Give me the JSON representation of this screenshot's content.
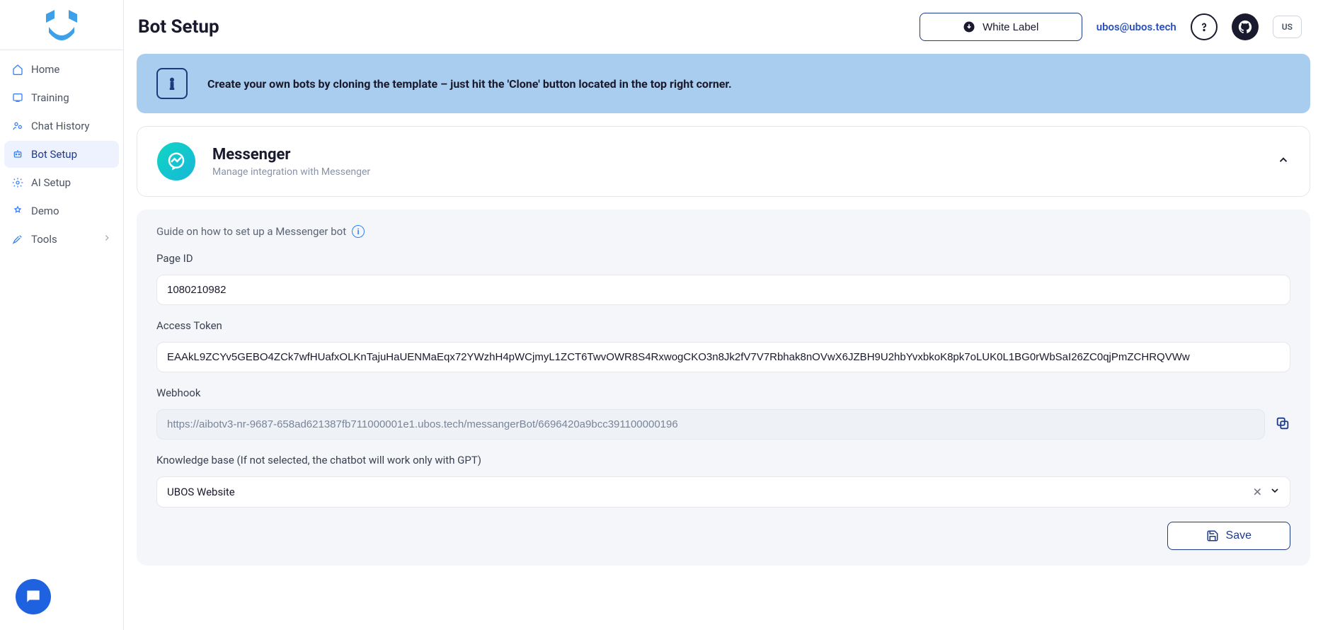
{
  "sidebar": {
    "items": [
      {
        "label": "Home",
        "icon": "home-icon"
      },
      {
        "label": "Training",
        "icon": "training-icon"
      },
      {
        "label": "Chat History",
        "icon": "chat-history-icon"
      },
      {
        "label": "Bot Setup",
        "icon": "bot-setup-icon"
      },
      {
        "label": "AI Setup",
        "icon": "ai-setup-icon"
      },
      {
        "label": "Demo",
        "icon": "demo-icon"
      },
      {
        "label": "Tools",
        "icon": "tools-icon"
      }
    ]
  },
  "header": {
    "title": "Bot Setup",
    "white_label": "White Label",
    "email": "ubos@ubos.tech",
    "locale": "US"
  },
  "banner": {
    "text": "Create your own bots by cloning the template – just hit the 'Clone' button located in the top right corner."
  },
  "channel": {
    "title": "Messenger",
    "subtitle": "Manage integration with Messenger"
  },
  "form": {
    "guide_label": "Guide on how to set up a Messenger bot",
    "page_id_label": "Page ID",
    "page_id_value": "1080210982",
    "access_token_label": "Access Token",
    "access_token_value": "EAAkL9ZCYv5GEBO4ZCk7wfHUafxOLKnTajuHaUENMaEqx72YWzhH4pWCjmyL1ZCT6TwvOWR8S4RxwogCKO3n8Jk2fV7V7Rbhak8nOVwX6JZBH9U2hbYvxbkoK8pk7oLUK0L1BG0rWbSaI26ZC0qjPmZCHRQVWw",
    "webhook_label": "Webhook",
    "webhook_value": "https://aibotv3-nr-9687-658ad621387fb711000001e1.ubos.tech/messangerBot/6696420a9bcc391100000196",
    "kb_label": "Knowledge base (If not selected, the chatbot will work only with GPT)",
    "kb_value": "UBOS Website",
    "save_label": "Save"
  }
}
